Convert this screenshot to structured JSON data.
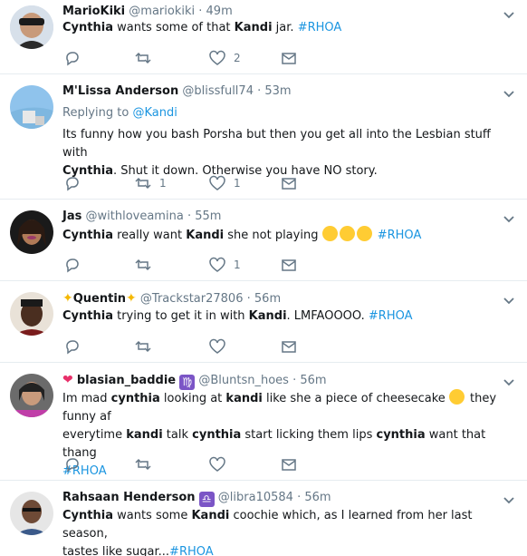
{
  "tweets": [
    {
      "name": "MarioKiki",
      "handle": "@mariokiki",
      "time": "49m",
      "text": {
        "a": "Cynthia",
        "b": " wants some of that ",
        "c": "Kandi",
        "d": " jar. ",
        "hash": "#RHOA"
      },
      "reply_count": "",
      "retweet_count": "",
      "like_count": "2"
    },
    {
      "name": "M'Lissa Anderson",
      "handle": "@blissfull74",
      "time": "53m",
      "replying_label": "Replying to ",
      "replying_to": "@Kandi",
      "text": {
        "a": "Its funny how you bash Porsha but then you get all into the Lesbian stuff with",
        "b": "Cynthia",
        "c": ".  Shut it down.  Otherwise you have NO story."
      },
      "retweet_count": "1",
      "like_count": "1"
    },
    {
      "name": "Jas",
      "handle": "@withloveamina",
      "time": "55m",
      "text": {
        "a": "Cynthia",
        "b": " really want ",
        "c": "Kandi",
        "d": " she not playing",
        "hash": "#RHOA"
      },
      "like_count": "1"
    },
    {
      "name": "Quentin",
      "handle": "@Trackstar27806",
      "time": "56m",
      "text": {
        "a": "Cynthia",
        "b": " trying to get it in with ",
        "c": "Kandi",
        "d": ". LMFAOOOO. ",
        "hash": "#RHOA"
      }
    },
    {
      "name": "blasian_baddie",
      "handle": "@Bluntsn_hoes",
      "time": "56m",
      "text": {
        "l1a": "Im mad ",
        "l1b": "cynthia",
        "l1c": " looking at ",
        "l1d": "kandi",
        "l1e": " like she a piece of cheesecake ",
        "l1f": " they funny af",
        "l2a": "everytime ",
        "l2b": "kandi",
        "l2c": " talk ",
        "l2d": "cynthia",
        "l2e": " start licking them lips ",
        "l2f": "cynthia",
        "l2g": " want that thang",
        "hash": "#RHOA"
      }
    },
    {
      "name": "Rahsaan Henderson",
      "handle": "@libra10584",
      "time": "56m",
      "text": {
        "a": "Cynthia",
        "b": " wants some ",
        "c": "Kandi",
        "d": " coochie which, as I learned from her last season,",
        "e": "tastes like sugar...",
        "hash": "#RHOA"
      }
    }
  ],
  "icons": {
    "reply": "reply-icon",
    "retweet": "retweet-icon",
    "like": "heart-icon",
    "dm": "envelope-icon",
    "menu": "chevron-down-icon"
  },
  "colors": {
    "link": "#1b95e0",
    "muted": "#657786",
    "border": "#e6ecf0"
  }
}
